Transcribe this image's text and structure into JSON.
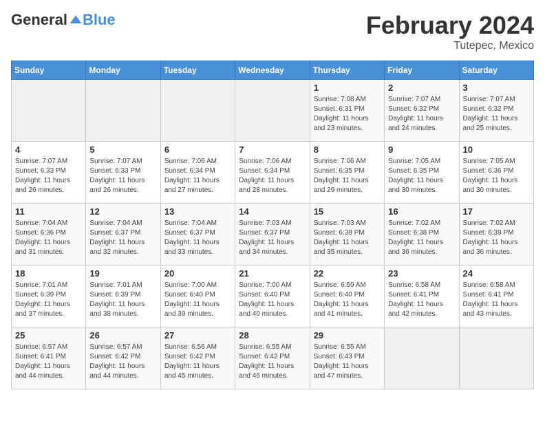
{
  "header": {
    "logo_general": "General",
    "logo_blue": "Blue",
    "title": "February 2024",
    "location": "Tutepec, Mexico"
  },
  "weekdays": [
    "Sunday",
    "Monday",
    "Tuesday",
    "Wednesday",
    "Thursday",
    "Friday",
    "Saturday"
  ],
  "weeks": [
    {
      "days": [
        {
          "num": "",
          "info": "",
          "empty": true
        },
        {
          "num": "",
          "info": "",
          "empty": true
        },
        {
          "num": "",
          "info": "",
          "empty": true
        },
        {
          "num": "",
          "info": "",
          "empty": true
        },
        {
          "num": "1",
          "info": "Sunrise: 7:08 AM\nSunset: 6:31 PM\nDaylight: 11 hours\nand 23 minutes.",
          "empty": false
        },
        {
          "num": "2",
          "info": "Sunrise: 7:07 AM\nSunset: 6:32 PM\nDaylight: 11 hours\nand 24 minutes.",
          "empty": false
        },
        {
          "num": "3",
          "info": "Sunrise: 7:07 AM\nSunset: 6:32 PM\nDaylight: 11 hours\nand 25 minutes.",
          "empty": false
        }
      ]
    },
    {
      "days": [
        {
          "num": "4",
          "info": "Sunrise: 7:07 AM\nSunset: 6:33 PM\nDaylight: 11 hours\nand 26 minutes.",
          "empty": false
        },
        {
          "num": "5",
          "info": "Sunrise: 7:07 AM\nSunset: 6:33 PM\nDaylight: 11 hours\nand 26 minutes.",
          "empty": false
        },
        {
          "num": "6",
          "info": "Sunrise: 7:06 AM\nSunset: 6:34 PM\nDaylight: 11 hours\nand 27 minutes.",
          "empty": false
        },
        {
          "num": "7",
          "info": "Sunrise: 7:06 AM\nSunset: 6:34 PM\nDaylight: 11 hours\nand 28 minutes.",
          "empty": false
        },
        {
          "num": "8",
          "info": "Sunrise: 7:06 AM\nSunset: 6:35 PM\nDaylight: 11 hours\nand 29 minutes.",
          "empty": false
        },
        {
          "num": "9",
          "info": "Sunrise: 7:05 AM\nSunset: 6:35 PM\nDaylight: 11 hours\nand 30 minutes.",
          "empty": false
        },
        {
          "num": "10",
          "info": "Sunrise: 7:05 AM\nSunset: 6:36 PM\nDaylight: 11 hours\nand 30 minutes.",
          "empty": false
        }
      ]
    },
    {
      "days": [
        {
          "num": "11",
          "info": "Sunrise: 7:04 AM\nSunset: 6:36 PM\nDaylight: 11 hours\nand 31 minutes.",
          "empty": false
        },
        {
          "num": "12",
          "info": "Sunrise: 7:04 AM\nSunset: 6:37 PM\nDaylight: 11 hours\nand 32 minutes.",
          "empty": false
        },
        {
          "num": "13",
          "info": "Sunrise: 7:04 AM\nSunset: 6:37 PM\nDaylight: 11 hours\nand 33 minutes.",
          "empty": false
        },
        {
          "num": "14",
          "info": "Sunrise: 7:03 AM\nSunset: 6:37 PM\nDaylight: 11 hours\nand 34 minutes.",
          "empty": false
        },
        {
          "num": "15",
          "info": "Sunrise: 7:03 AM\nSunset: 6:38 PM\nDaylight: 11 hours\nand 35 minutes.",
          "empty": false
        },
        {
          "num": "16",
          "info": "Sunrise: 7:02 AM\nSunset: 6:38 PM\nDaylight: 11 hours\nand 36 minutes.",
          "empty": false
        },
        {
          "num": "17",
          "info": "Sunrise: 7:02 AM\nSunset: 6:39 PM\nDaylight: 11 hours\nand 36 minutes.",
          "empty": false
        }
      ]
    },
    {
      "days": [
        {
          "num": "18",
          "info": "Sunrise: 7:01 AM\nSunset: 6:39 PM\nDaylight: 11 hours\nand 37 minutes.",
          "empty": false
        },
        {
          "num": "19",
          "info": "Sunrise: 7:01 AM\nSunset: 6:39 PM\nDaylight: 11 hours\nand 38 minutes.",
          "empty": false
        },
        {
          "num": "20",
          "info": "Sunrise: 7:00 AM\nSunset: 6:40 PM\nDaylight: 11 hours\nand 39 minutes.",
          "empty": false
        },
        {
          "num": "21",
          "info": "Sunrise: 7:00 AM\nSunset: 6:40 PM\nDaylight: 11 hours\nand 40 minutes.",
          "empty": false
        },
        {
          "num": "22",
          "info": "Sunrise: 6:59 AM\nSunset: 6:40 PM\nDaylight: 11 hours\nand 41 minutes.",
          "empty": false
        },
        {
          "num": "23",
          "info": "Sunrise: 6:58 AM\nSunset: 6:41 PM\nDaylight: 11 hours\nand 42 minutes.",
          "empty": false
        },
        {
          "num": "24",
          "info": "Sunrise: 6:58 AM\nSunset: 6:41 PM\nDaylight: 11 hours\nand 43 minutes.",
          "empty": false
        }
      ]
    },
    {
      "days": [
        {
          "num": "25",
          "info": "Sunrise: 6:57 AM\nSunset: 6:41 PM\nDaylight: 11 hours\nand 44 minutes.",
          "empty": false
        },
        {
          "num": "26",
          "info": "Sunrise: 6:57 AM\nSunset: 6:42 PM\nDaylight: 11 hours\nand 44 minutes.",
          "empty": false
        },
        {
          "num": "27",
          "info": "Sunrise: 6:56 AM\nSunset: 6:42 PM\nDaylight: 11 hours\nand 45 minutes.",
          "empty": false
        },
        {
          "num": "28",
          "info": "Sunrise: 6:55 AM\nSunset: 6:42 PM\nDaylight: 11 hours\nand 46 minutes.",
          "empty": false
        },
        {
          "num": "29",
          "info": "Sunrise: 6:55 AM\nSunset: 6:43 PM\nDaylight: 11 hours\nand 47 minutes.",
          "empty": false
        },
        {
          "num": "",
          "info": "",
          "empty": true
        },
        {
          "num": "",
          "info": "",
          "empty": true
        }
      ]
    }
  ]
}
